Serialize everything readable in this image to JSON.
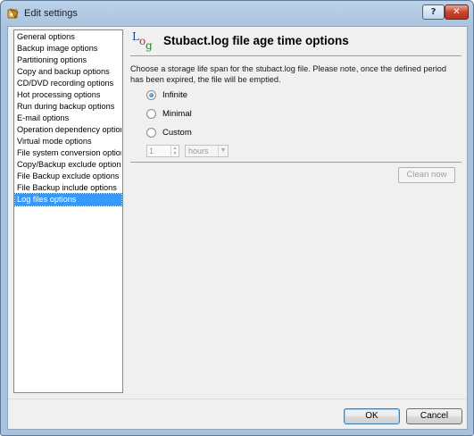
{
  "window": {
    "title": "Edit settings"
  },
  "title_buttons": {
    "help": "?",
    "close": "✕"
  },
  "sidebar": {
    "items": [
      {
        "label": "General options",
        "selected": false
      },
      {
        "label": "Backup image options",
        "selected": false
      },
      {
        "label": "Partitioning options",
        "selected": false
      },
      {
        "label": "Copy and backup options",
        "selected": false
      },
      {
        "label": "CD/DVD recording options",
        "selected": false
      },
      {
        "label": "Hot processing options",
        "selected": false
      },
      {
        "label": "Run during backup options",
        "selected": false
      },
      {
        "label": "E-mail options",
        "selected": false
      },
      {
        "label": "Operation dependency options",
        "selected": false
      },
      {
        "label": "Virtual mode options",
        "selected": false
      },
      {
        "label": "File system conversion options",
        "selected": false
      },
      {
        "label": "Copy/Backup exclude options",
        "selected": false
      },
      {
        "label": "File Backup exclude options",
        "selected": false
      },
      {
        "label": "File Backup include options",
        "selected": false
      },
      {
        "label": "Log files options",
        "selected": true
      }
    ]
  },
  "main": {
    "logo_letters": {
      "l": "L",
      "o": "o",
      "g": "g"
    },
    "title": "Stubact.log file age time options",
    "description": "Choose a storage life span for the stubact.log file. Please note, once the defined period has been expired, the file will be emptied.",
    "radios": [
      {
        "label": "Infinite",
        "checked": true
      },
      {
        "label": "Minimal",
        "checked": false
      },
      {
        "label": "Custom",
        "checked": false
      }
    ],
    "custom_value": "1",
    "custom_unit": "hours",
    "clean_button": "Clean now"
  },
  "footer": {
    "ok": "OK",
    "cancel": "Cancel"
  },
  "colors": {
    "selection": "#3399ff",
    "title_bar": "#bcd2e8",
    "close_button": "#c8462f"
  }
}
